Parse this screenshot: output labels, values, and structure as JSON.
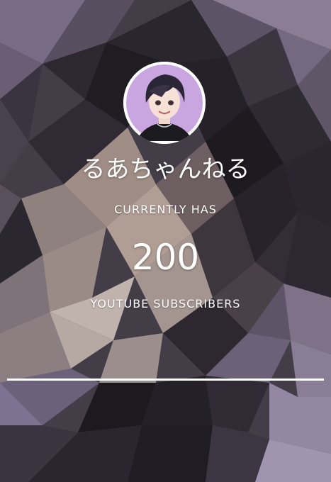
{
  "channel": {
    "name": "るあちゃんねる"
  },
  "counter": {
    "prefix": "CURRENTLY HAS",
    "value": "200",
    "suffix": "YOUTUBE SUBSCRIBERS"
  },
  "progress": {
    "fraction": 1.0
  },
  "colors": {
    "text": "#ffffff",
    "avatar_border": "#ffffff",
    "avatar_bg": "#c9a6e0",
    "progress_line": "#ffffff"
  },
  "icons": {
    "avatar": "anime-boy-avatar"
  }
}
